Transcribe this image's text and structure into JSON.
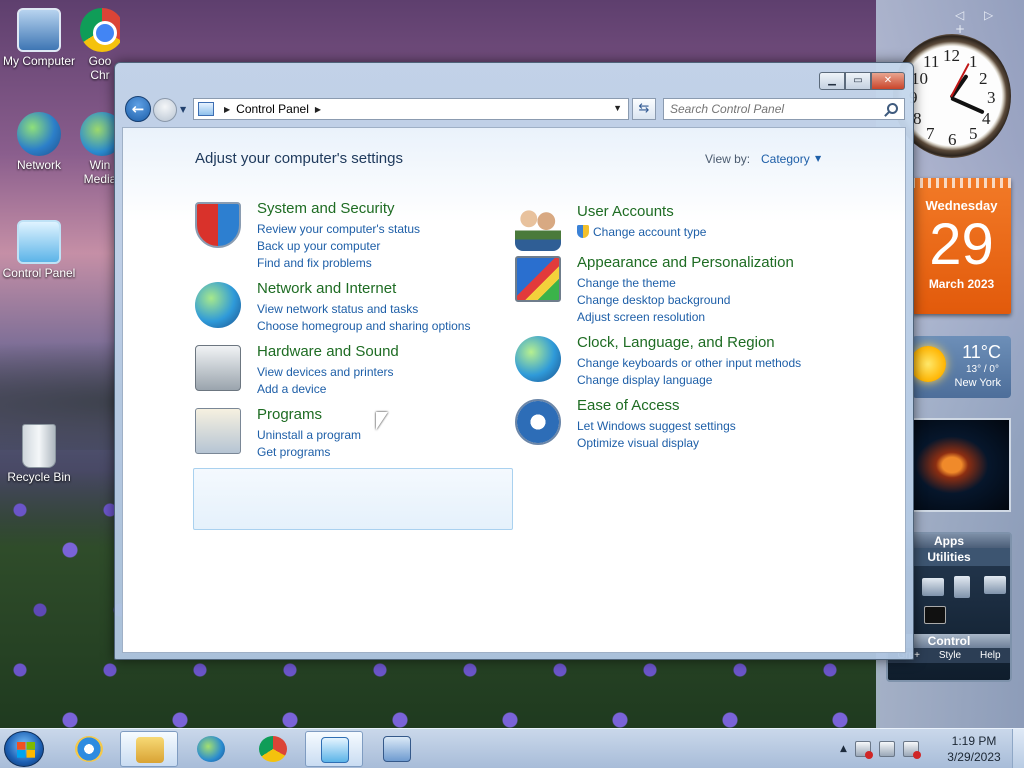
{
  "desktop": {
    "icons": [
      {
        "id": "my-computer",
        "label": "My Computer"
      },
      {
        "id": "chrome",
        "label": "Goo\nChr"
      },
      {
        "id": "network",
        "label": "Network"
      },
      {
        "id": "wmp",
        "label": "Win\nMedia"
      },
      {
        "id": "control-panel",
        "label": "Control Panel"
      },
      {
        "id": "recycle-bin",
        "label": "Recycle Bin"
      }
    ]
  },
  "gadgets": {
    "nav": "◁ ▷ +",
    "clock": {
      "numbers": [
        "12",
        "1",
        "2",
        "3",
        "4",
        "5",
        "6",
        "7",
        "8",
        "9",
        "10",
        "11"
      ],
      "time": "1:19"
    },
    "calendar": {
      "day": "Wednesday",
      "date": "29",
      "month": "March 2023",
      "accent": "#e8621a"
    },
    "weather": {
      "temp": "11°C",
      "range": "13° / 0°",
      "city": "New York"
    },
    "apps": {
      "title": "Apps",
      "subtitle": "Utilities",
      "control": "Control",
      "footer": [
        "Grp+",
        "Style",
        "Help"
      ]
    }
  },
  "window": {
    "title_buttons": {
      "minimize": "▁",
      "maximize": "▭",
      "close": "✕"
    },
    "address": {
      "crumb": "Control Panel"
    },
    "search": {
      "placeholder": "Search Control Panel"
    },
    "heading": "Adjust your computer's settings",
    "view_by": {
      "label": "View by:",
      "value": "Category"
    },
    "categories_left": [
      {
        "title": "System and Security",
        "icon": "shield-icon",
        "links": [
          "Review your computer's status",
          "Back up your computer",
          "Find and fix problems"
        ]
      },
      {
        "title": "Network and Internet",
        "icon": "globe-network-icon",
        "links": [
          "View network status and tasks",
          "Choose homegroup and sharing options"
        ]
      },
      {
        "title": "Hardware and Sound",
        "icon": "printer-icon",
        "links": [
          "View devices and printers",
          "Add a device"
        ]
      },
      {
        "title": "Programs",
        "icon": "programs-icon",
        "links": [
          "Uninstall a program",
          "Get programs"
        ]
      }
    ],
    "categories_right": [
      {
        "title": "User Accounts",
        "icon": "users-icon",
        "links": [
          "Change account type"
        ]
      },
      {
        "title": "Appearance and Personalization",
        "icon": "appearance-icon",
        "links": [
          "Change the theme",
          "Change desktop background",
          "Adjust screen resolution"
        ]
      },
      {
        "title": "Clock, Language, and Region",
        "icon": "clock-globe-icon",
        "links": [
          "Change keyboards or other input methods",
          "Change display language"
        ]
      },
      {
        "title": "Ease of Access",
        "icon": "ease-of-access-icon",
        "links": [
          "Let Windows suggest settings",
          "Optimize visual display"
        ]
      }
    ],
    "colors": {
      "category_title": "#1e6c23",
      "link": "#1e5fa8",
      "heading": "#1e395b"
    }
  },
  "taskbar": {
    "items": [
      "start",
      "internet-explorer",
      "windows-explorer",
      "windows-media-player",
      "chrome",
      "control-panel",
      "remote-desktop"
    ],
    "active": "windows-explorer",
    "clock": {
      "time": "1:19 PM",
      "date": "3/29/2023"
    }
  }
}
